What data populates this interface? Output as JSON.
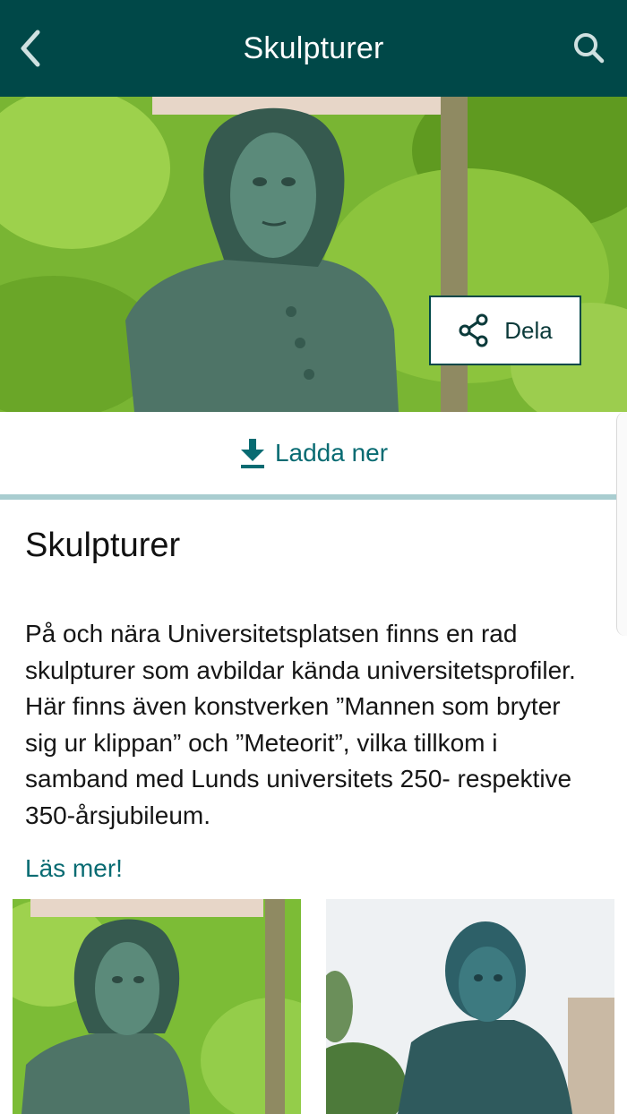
{
  "header": {
    "title": "Skulpturer",
    "back_icon": "chevron-left-icon",
    "search_icon": "search-icon"
  },
  "hero": {
    "share_label": "Dela",
    "share_icon": "share-icon"
  },
  "download": {
    "label": "Ladda ner",
    "icon": "download-icon"
  },
  "content": {
    "title": "Skulpturer",
    "description": "På och nära Universitetsplatsen finns en rad skulpturer som avbildar kända universitetsprofiler. Här finns även konstverken ”Mannen som bryter sig ur klippan” och ”Meteorit”, vilka tillkom i samband med Lunds universitets 250- respektive 350-årsjubileum.",
    "read_more": "Läs mer!"
  },
  "colors": {
    "header_bg": "#004848",
    "accent": "#086b72",
    "divider": "#a9cdd0"
  }
}
